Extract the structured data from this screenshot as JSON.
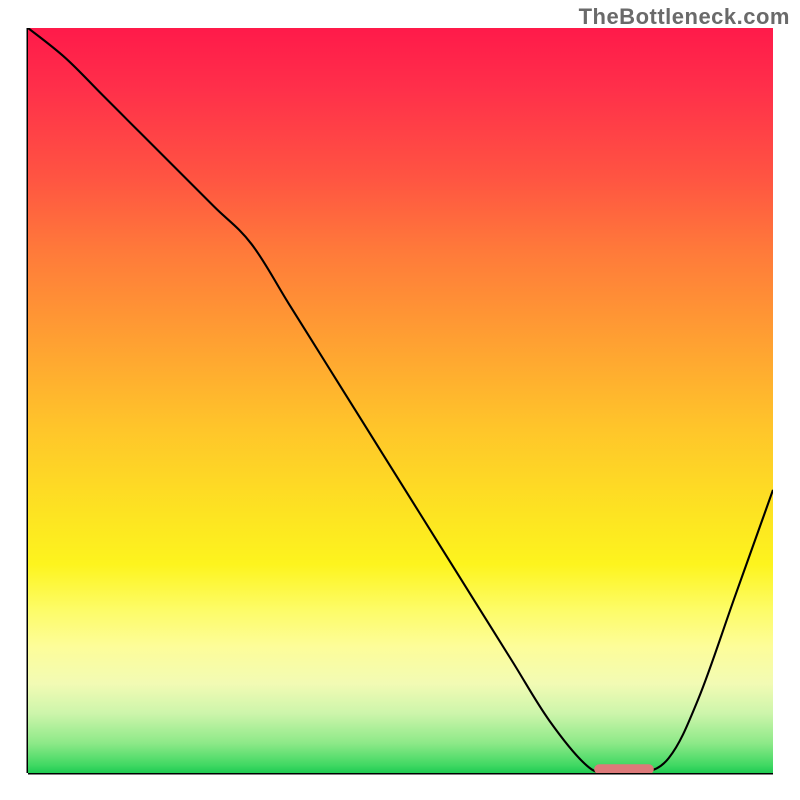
{
  "attribution": "TheBottleneck.com",
  "chart_data": {
    "type": "line",
    "title": "",
    "xlabel": "",
    "ylabel": "",
    "xlim": [
      0,
      100
    ],
    "ylim": [
      0,
      100
    ],
    "x": [
      0,
      5,
      10,
      15,
      20,
      25,
      30,
      35,
      40,
      45,
      50,
      55,
      60,
      65,
      70,
      75,
      78,
      82,
      86,
      90,
      95,
      100
    ],
    "values": [
      100,
      96,
      91,
      86,
      81,
      76,
      71,
      63,
      55,
      47,
      39,
      31,
      23,
      15,
      7,
      1,
      0,
      0,
      2,
      10,
      24,
      38
    ],
    "marker_segment": {
      "x_start": 76,
      "x_end": 84,
      "y": 0.5
    },
    "background_gradient": [
      "#ff1a4a",
      "#ffa032",
      "#fdf41e",
      "#1fcb52"
    ]
  }
}
